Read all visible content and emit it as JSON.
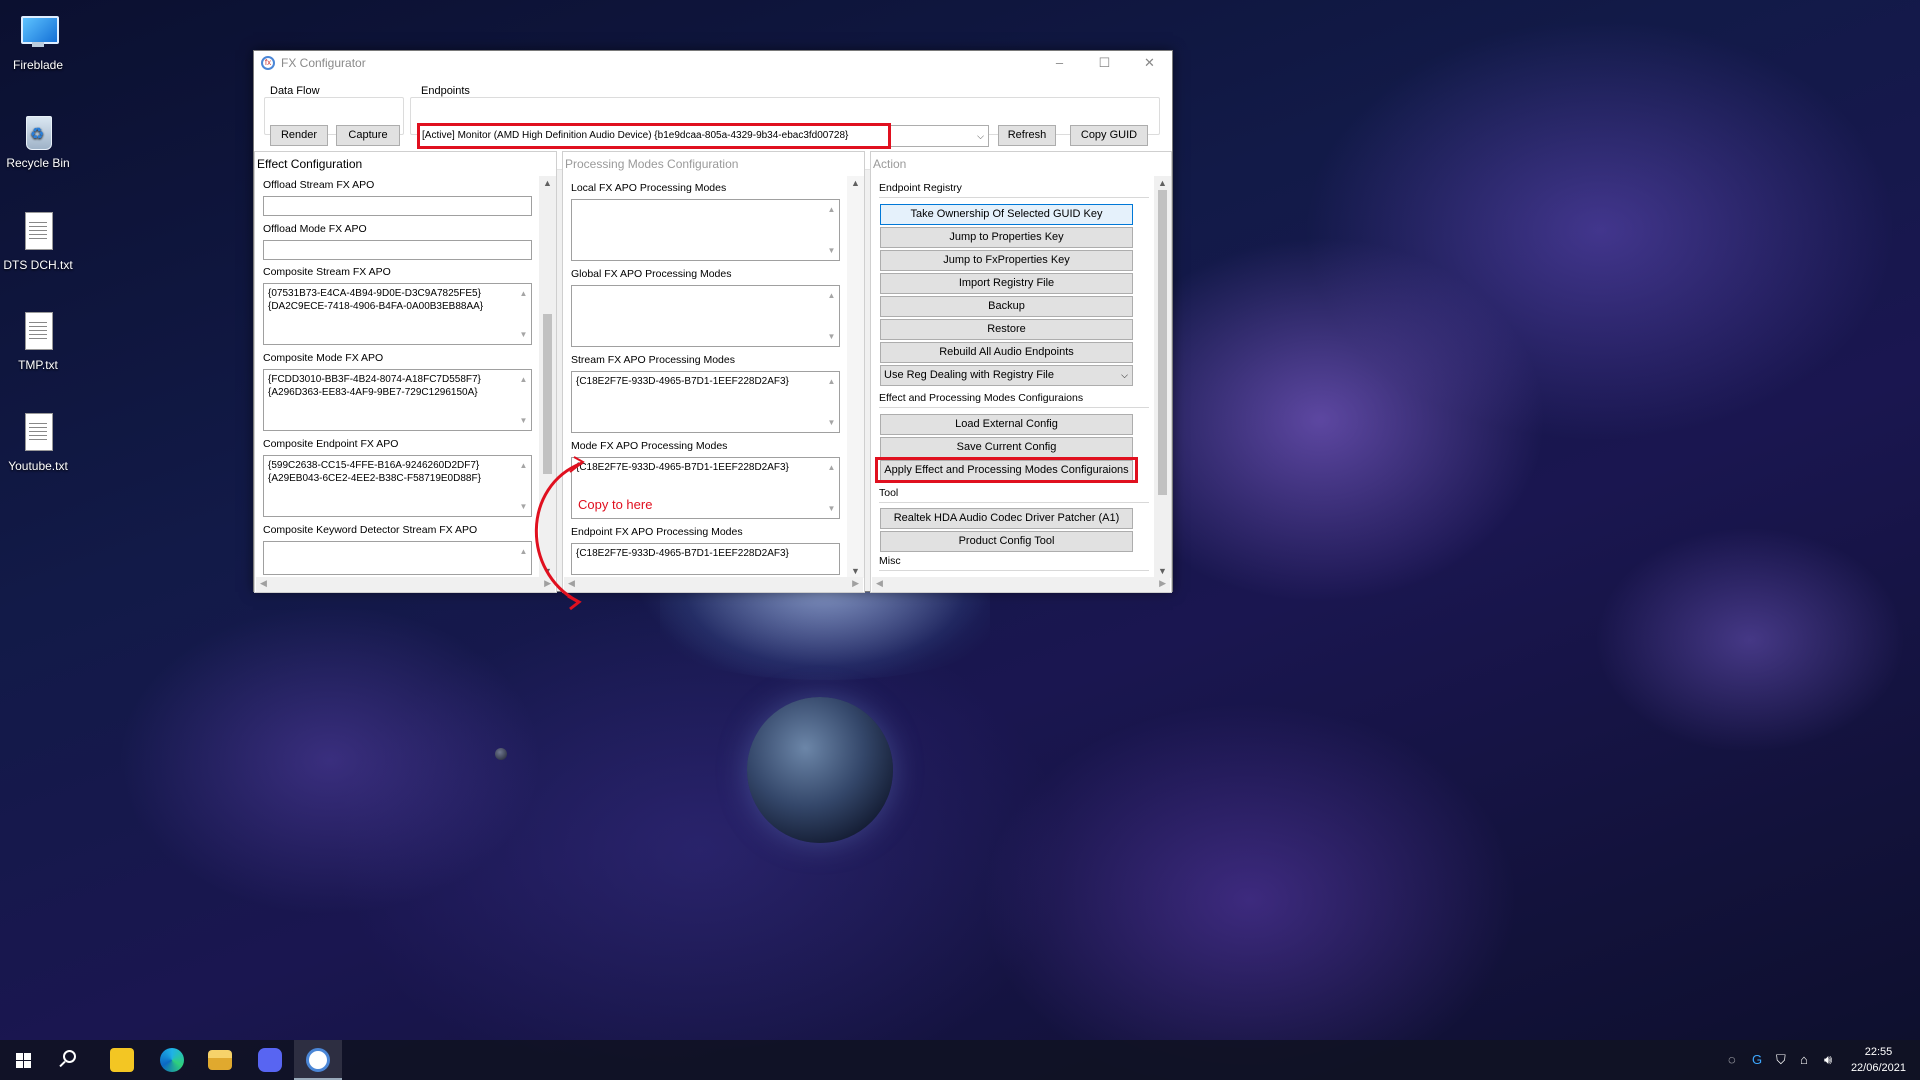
{
  "desktop": {
    "icons": [
      {
        "label": "Fireblade",
        "icon": "monitor-icon"
      },
      {
        "label": "Recycle Bin",
        "icon": "recycle-bin-icon"
      },
      {
        "label": "DTS DCH.txt",
        "icon": "text-file-icon"
      },
      {
        "label": "TMP.txt",
        "icon": "text-file-icon"
      },
      {
        "label": "Youtube.txt",
        "icon": "text-file-icon"
      }
    ]
  },
  "window": {
    "title": "FX Configurator",
    "controls": {
      "minimize": "–",
      "maximize": "☐",
      "close": "✕"
    }
  },
  "data_flow": {
    "label": "Data Flow",
    "render": "Render",
    "capture": "Capture"
  },
  "endpoints": {
    "label": "Endpoints",
    "selected": "[Active] Monitor (AMD High Definition Audio Device) {b1e9dcaa-805a-4329-9b34-ebac3fd00728}",
    "refresh": "Refresh",
    "copy_guid": "Copy GUID"
  },
  "effect_config": {
    "heading": "Effect Configuration",
    "offload_stream_label": "Offload Stream FX APO",
    "offload_stream_value": "",
    "offload_mode_label": "Offload Mode FX APO",
    "offload_mode_value": "",
    "composite_stream_label": "Composite Stream FX APO",
    "composite_stream_lines": [
      "{07531B73-E4CA-4B94-9D0E-D3C9A7825FE5}",
      "{DA2C9ECE-7418-4906-B4FA-0A00B3EB88AA}"
    ],
    "composite_mode_label": "Composite Mode FX APO",
    "composite_mode_lines": [
      "{FCDD3010-BB3F-4B24-8074-A18FC7D558F7}",
      "{A296D363-EE83-4AF9-9BE7-729C1296150A}"
    ],
    "composite_endpoint_label": "Composite Endpoint FX APO",
    "composite_endpoint_lines": [
      "{599C2638-CC15-4FFE-B16A-9246260D2DF7}",
      "{A29EB043-6CE2-4EE2-B38C-F58719E0D88F}"
    ],
    "composite_keyword_label": "Composite Keyword Detector Stream FX APO"
  },
  "processing_modes": {
    "heading": "Processing Modes Configuration",
    "local_label": "Local FX APO Processing Modes",
    "global_label": "Global FX APO Processing Modes",
    "stream_label": "Stream FX APO Processing Modes",
    "stream_value": "{C18E2F7E-933D-4965-B7D1-1EEF228D2AF3}",
    "mode_label": "Mode FX APO Processing Modes",
    "mode_value": "{C18E2F7E-933D-4965-B7D1-1EEF228D2AF3}",
    "endpoint_label": "Endpoint FX APO Processing Modes",
    "endpoint_value": "{C18E2F7E-933D-4965-B7D1-1EEF228D2AF3}"
  },
  "annotation": {
    "text": "Copy to here",
    "color": "#e0101f"
  },
  "action": {
    "heading": "Action",
    "registry_section": "Endpoint Registry",
    "take_ownership": "Take Ownership Of Selected GUID Key",
    "jump_properties": "Jump to Properties Key",
    "jump_fxproperties": "Jump to FxProperties Key",
    "import_registry": "Import Registry File",
    "backup": "Backup",
    "restore": "Restore",
    "rebuild": "Rebuild All Audio Endpoints",
    "reg_dealing_select": "Use Reg Dealing with Registry File",
    "effect_section": "Effect and Processing Modes Configuraions",
    "load_external": "Load External Config",
    "save_current": "Save Current Config",
    "apply_effect": "Apply Effect and Processing Modes Configuraions",
    "tool_section": "Tool",
    "realtek_patcher": "Realtek HDA Audio Codec Driver Patcher (A1)",
    "product_config": "Product Config Tool",
    "misc_section": "Misc"
  },
  "taskbar": {
    "items": [
      "start-icon",
      "search-icon",
      "file-manager-app-icon",
      "edge-icon",
      "file-explorer-icon",
      "discord-icon",
      "fx-configurator-icon"
    ],
    "time": "22:55",
    "date": "22/06/2021"
  },
  "colors": {
    "highlight_red": "#e0101f",
    "button_face": "#e1e1e1",
    "window_bg": "#f0f0f0"
  }
}
